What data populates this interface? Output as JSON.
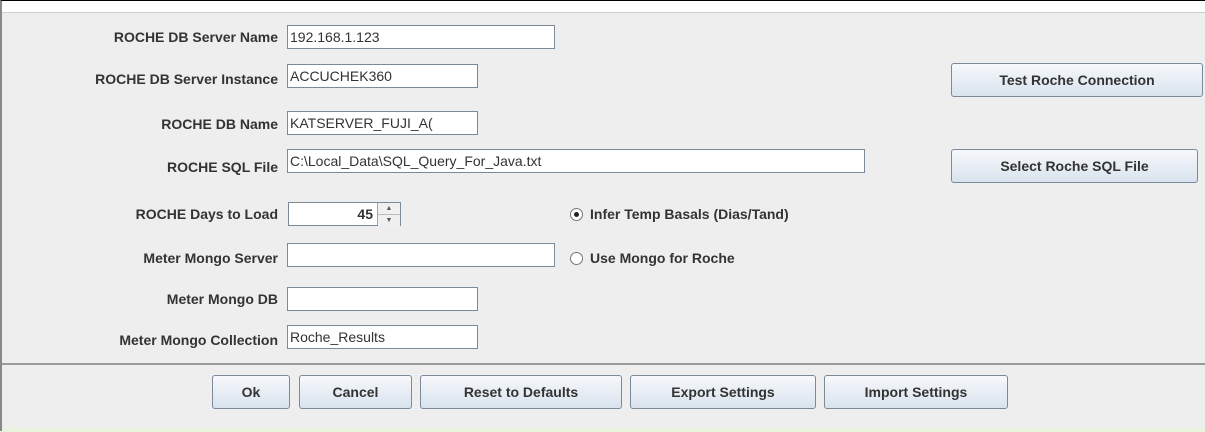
{
  "fields": {
    "server_name": {
      "label": "ROCHE DB Server Name",
      "value": "192.168.1.123"
    },
    "server_instance": {
      "label": "ROCHE DB Server Instance",
      "value": "ACCUCHEK360"
    },
    "db_name": {
      "label": "ROCHE DB Name",
      "value": "KATSERVER_FUJI_A("
    },
    "sql_file": {
      "label": "ROCHE SQL File",
      "value": "C:\\Local_Data\\SQL_Query_For_Java.txt"
    },
    "days_to_load": {
      "label": "ROCHE Days to Load",
      "value": "45"
    },
    "mongo_server": {
      "label": "Meter Mongo Server",
      "value": ""
    },
    "mongo_db": {
      "label": "Meter Mongo DB",
      "value": ""
    },
    "mongo_collection": {
      "label": "Meter Mongo Collection",
      "value": "Roche_Results"
    }
  },
  "options": {
    "infer_temp_basals": {
      "label": "Infer Temp Basals (Dias/Tand)",
      "selected": true
    },
    "use_mongo": {
      "label": "Use Mongo for Roche",
      "selected": false
    }
  },
  "side_buttons": {
    "test_connection": "Test Roche Connection",
    "select_sql": "Select Roche SQL File"
  },
  "bottom_buttons": {
    "ok": "Ok",
    "cancel": "Cancel",
    "reset": "Reset to Defaults",
    "export": "Export Settings",
    "import": "Import Settings"
  },
  "icons": {
    "spinner": "spinner-arrows-icon",
    "radio": "radio-button-icon"
  }
}
